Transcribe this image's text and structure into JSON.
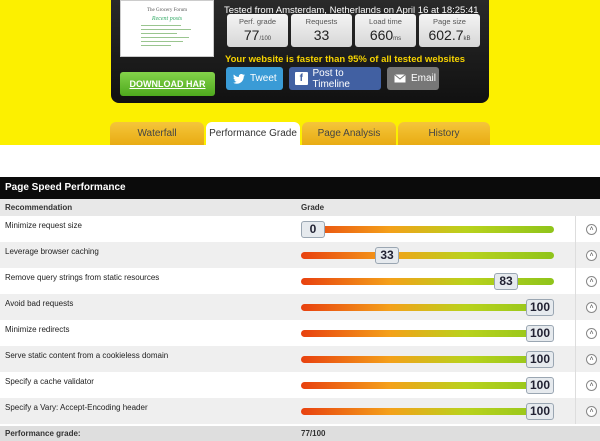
{
  "header": {
    "thumbnail": {
      "site_name": "The Grocery Forum",
      "headline": "Recent posts"
    },
    "download_label": "DOWNLOAD HAR",
    "tested_from": "Tested from Amsterdam, Netherlands on April 16 at 18:25:41",
    "stats": [
      {
        "label": "Perf. grade",
        "value": "77",
        "unit": "/100"
      },
      {
        "label": "Requests",
        "value": "33",
        "unit": ""
      },
      {
        "label": "Load time",
        "value": "660",
        "unit": "ms"
      },
      {
        "label": "Page size",
        "value": "602.7",
        "unit": "kB"
      }
    ],
    "faster_prefix": "Your website is ",
    "faster_highlight": "faster than 95%",
    "faster_suffix": " of all tested websites",
    "share": {
      "tweet": "Tweet",
      "facebook": "Post to Timeline",
      "email": "Email"
    }
  },
  "tabs": [
    {
      "label": "Waterfall",
      "active": false
    },
    {
      "label": "Performance Grade",
      "active": true
    },
    {
      "label": "Page Analysis",
      "active": false
    },
    {
      "label": "History",
      "active": false
    }
  ],
  "section_title": "Page Speed Performance",
  "table": {
    "columns": [
      "Recommendation",
      "Grade"
    ],
    "rows": [
      {
        "recommendation": "Minimize request size",
        "grade": 0
      },
      {
        "recommendation": "Leverage browser caching",
        "grade": 33
      },
      {
        "recommendation": "Remove query strings from static resources",
        "grade": 83
      },
      {
        "recommendation": "Avoid bad requests",
        "grade": 100
      },
      {
        "recommendation": "Minimize redirects",
        "grade": 100
      },
      {
        "recommendation": "Serve static content from a cookieless domain",
        "grade": 100
      },
      {
        "recommendation": "Specify a cache validator",
        "grade": 100
      },
      {
        "recommendation": "Specify a Vary: Accept-Encoding header",
        "grade": 100
      }
    ]
  },
  "footer": {
    "label": "Performance grade:",
    "value": "77/100"
  },
  "colors": {
    "brand_yellow": "#fcf000",
    "panel_dark": "#111111",
    "tab_gold": "#e8ab13",
    "download_green": "#4ea91d",
    "faster_text": "#f6d300"
  },
  "icons": {
    "twitter": "twitter-bird-icon",
    "facebook": "facebook-icon",
    "email": "envelope-icon",
    "expand": "chevron-up-icon"
  }
}
